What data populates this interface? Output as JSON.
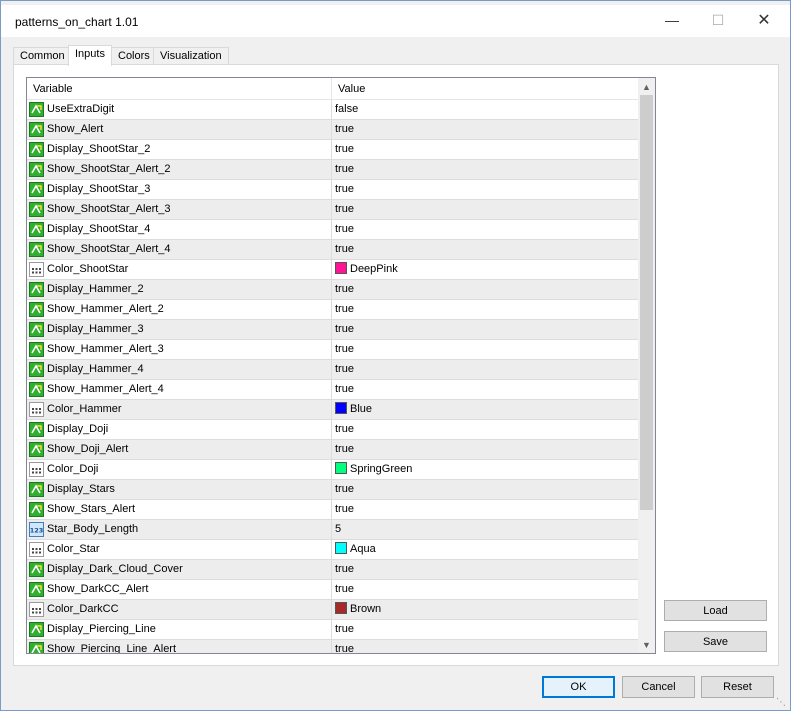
{
  "window": {
    "title": "patterns_on_chart 1.01"
  },
  "tabs": [
    {
      "label": "Common"
    },
    {
      "label": "Inputs"
    },
    {
      "label": "Colors"
    },
    {
      "label": "Visualization"
    }
  ],
  "grid": {
    "headers": {
      "variable": "Variable",
      "value": "Value"
    },
    "rows": [
      {
        "icon": "bool-icon",
        "name": "UseExtraDigit",
        "value": "false"
      },
      {
        "icon": "bool-icon",
        "name": "Show_Alert",
        "value": "true"
      },
      {
        "icon": "bool-icon",
        "name": "Display_ShootStar_2",
        "value": "true"
      },
      {
        "icon": "bool-icon",
        "name": "Show_ShootStar_Alert_2",
        "value": "true"
      },
      {
        "icon": "bool-icon",
        "name": "Display_ShootStar_3",
        "value": "true"
      },
      {
        "icon": "bool-icon",
        "name": "Show_ShootStar_Alert_3",
        "value": "true"
      },
      {
        "icon": "bool-icon",
        "name": "Display_ShootStar_4",
        "value": "true"
      },
      {
        "icon": "bool-icon",
        "name": "Show_ShootStar_Alert_4",
        "value": "true"
      },
      {
        "icon": "color-icon",
        "name": "Color_ShootStar",
        "value": "DeepPink",
        "swatch": "#ff1493"
      },
      {
        "icon": "bool-icon",
        "name": "Display_Hammer_2",
        "value": "true"
      },
      {
        "icon": "bool-icon",
        "name": "Show_Hammer_Alert_2",
        "value": "true"
      },
      {
        "icon": "bool-icon",
        "name": "Display_Hammer_3",
        "value": "true"
      },
      {
        "icon": "bool-icon",
        "name": "Show_Hammer_Alert_3",
        "value": "true"
      },
      {
        "icon": "bool-icon",
        "name": "Display_Hammer_4",
        "value": "true"
      },
      {
        "icon": "bool-icon",
        "name": "Show_Hammer_Alert_4",
        "value": "true"
      },
      {
        "icon": "color-icon",
        "name": "Color_Hammer",
        "value": "Blue",
        "swatch": "#0000ff"
      },
      {
        "icon": "bool-icon",
        "name": "Display_Doji",
        "value": "true"
      },
      {
        "icon": "bool-icon",
        "name": "Show_Doji_Alert",
        "value": "true"
      },
      {
        "icon": "color-icon",
        "name": "Color_Doji",
        "value": "SpringGreen",
        "swatch": "#00ff7f"
      },
      {
        "icon": "bool-icon",
        "name": "Display_Stars",
        "value": "true"
      },
      {
        "icon": "bool-icon",
        "name": "Show_Stars_Alert",
        "value": "true"
      },
      {
        "icon": "int-icon",
        "name": "Star_Body_Length",
        "value": "5"
      },
      {
        "icon": "color-icon",
        "name": "Color_Star",
        "value": "Aqua",
        "swatch": "#00ffff"
      },
      {
        "icon": "bool-icon",
        "name": "Display_Dark_Cloud_Cover",
        "value": "true"
      },
      {
        "icon": "bool-icon",
        "name": "Show_DarkCC_Alert",
        "value": "true"
      },
      {
        "icon": "color-icon",
        "name": "Color_DarkCC",
        "value": "Brown",
        "swatch": "#a52a2a"
      },
      {
        "icon": "bool-icon",
        "name": "Display_Piercing_Line",
        "value": "true"
      },
      {
        "icon": "bool-icon",
        "name": "Show_Piercing_Line_Alert",
        "value": "true"
      }
    ]
  },
  "buttons": {
    "load": "Load",
    "save": "Save",
    "ok": "OK",
    "cancel": "Cancel",
    "reset": "Reset"
  },
  "colors": {
    "accent": "#0078d7",
    "row_alt": "#ededed",
    "bool_icon_green": "#2fb12f"
  }
}
